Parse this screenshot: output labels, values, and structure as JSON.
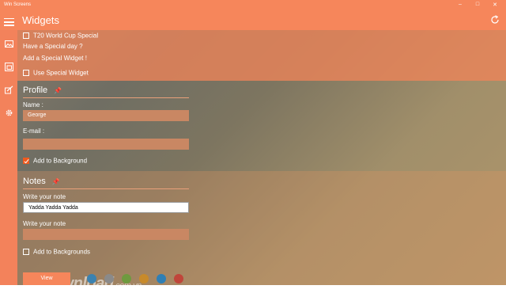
{
  "window": {
    "title": "Win Screens",
    "controls": [
      "minimize-icon",
      "restore-icon",
      "close-icon"
    ]
  },
  "appbar": {
    "title": "Widgets",
    "refresh_icon": "refresh-icon"
  },
  "sidebar": {
    "items": [
      "hamburger-icon",
      "image-icon",
      "widget-icon",
      "brush-icon",
      "gear-icon"
    ]
  },
  "special": {
    "t20_label": "T20 World Cup Special",
    "t20_checked": false,
    "prompt": "Have a Special day ?",
    "add_prompt": "Add a Special Widget !",
    "use_label": "Use Special Widget",
    "use_checked": false
  },
  "profile": {
    "title": "Profile",
    "name_label": "Name :",
    "name_value": "George",
    "email_label": "E-mail :",
    "email_value": "",
    "add_bg_label": "Add to Background",
    "add_bg_checked": true
  },
  "notes": {
    "title": "Notes",
    "note1_label": "Write your note",
    "note1_value": "Yadda Yadda Yadda",
    "note2_label": "Write your note",
    "note2_value": "",
    "add_bg_label": "Add to Backgrounds",
    "add_bg_checked": false
  },
  "footer": {
    "view_label": "View",
    "swatches": [
      "#3b82b0",
      "#8a8a8a",
      "#6f9a3f",
      "#c88a2a",
      "#2f7fb5",
      "#c0453a"
    ]
  },
  "watermark": {
    "brand": "Download",
    "tld": ".com.vn"
  },
  "colors": {
    "accent": "#f6865b",
    "checked": "#f05a1e"
  }
}
